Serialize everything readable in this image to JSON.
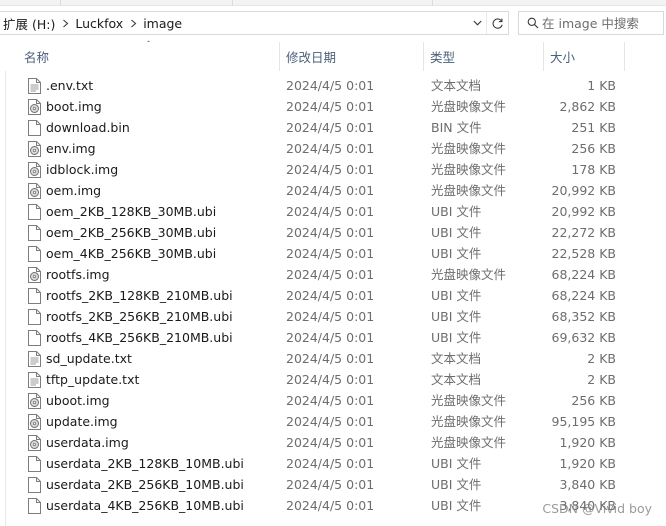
{
  "address": {
    "crumbs": [
      "扩展 (H:)",
      "Luckfox",
      "image"
    ]
  },
  "search": {
    "placeholder": "在 image 中搜索"
  },
  "columns": {
    "name": "名称",
    "date": "修改日期",
    "type": "类型",
    "size": "大小"
  },
  "files": [
    {
      "name": ".env.txt",
      "date": "2024/4/5 0:01",
      "type": "文本文档",
      "size": "1 KB",
      "icon": "text-file-icon"
    },
    {
      "name": "boot.img",
      "date": "2024/4/5 0:01",
      "type": "光盘映像文件",
      "size": "2,862 KB",
      "icon": "disc-image-icon"
    },
    {
      "name": "download.bin",
      "date": "2024/4/5 0:01",
      "type": "BIN 文件",
      "size": "251 KB",
      "icon": "file-icon"
    },
    {
      "name": "env.img",
      "date": "2024/4/5 0:01",
      "type": "光盘映像文件",
      "size": "256 KB",
      "icon": "disc-image-icon"
    },
    {
      "name": "idblock.img",
      "date": "2024/4/5 0:01",
      "type": "光盘映像文件",
      "size": "178 KB",
      "icon": "disc-image-icon"
    },
    {
      "name": "oem.img",
      "date": "2024/4/5 0:01",
      "type": "光盘映像文件",
      "size": "20,992 KB",
      "icon": "disc-image-icon"
    },
    {
      "name": "oem_2KB_128KB_30MB.ubi",
      "date": "2024/4/5 0:01",
      "type": "UBI 文件",
      "size": "20,992 KB",
      "icon": "file-icon"
    },
    {
      "name": "oem_2KB_256KB_30MB.ubi",
      "date": "2024/4/5 0:01",
      "type": "UBI 文件",
      "size": "22,272 KB",
      "icon": "file-icon"
    },
    {
      "name": "oem_4KB_256KB_30MB.ubi",
      "date": "2024/4/5 0:01",
      "type": "UBI 文件",
      "size": "22,528 KB",
      "icon": "file-icon"
    },
    {
      "name": "rootfs.img",
      "date": "2024/4/5 0:01",
      "type": "光盘映像文件",
      "size": "68,224 KB",
      "icon": "disc-image-icon"
    },
    {
      "name": "rootfs_2KB_128KB_210MB.ubi",
      "date": "2024/4/5 0:01",
      "type": "UBI 文件",
      "size": "68,224 KB",
      "icon": "file-icon"
    },
    {
      "name": "rootfs_2KB_256KB_210MB.ubi",
      "date": "2024/4/5 0:01",
      "type": "UBI 文件",
      "size": "68,352 KB",
      "icon": "file-icon"
    },
    {
      "name": "rootfs_4KB_256KB_210MB.ubi",
      "date": "2024/4/5 0:01",
      "type": "UBI 文件",
      "size": "69,632 KB",
      "icon": "file-icon"
    },
    {
      "name": "sd_update.txt",
      "date": "2024/4/5 0:01",
      "type": "文本文档",
      "size": "2 KB",
      "icon": "text-file-icon"
    },
    {
      "name": "tftp_update.txt",
      "date": "2024/4/5 0:01",
      "type": "文本文档",
      "size": "2 KB",
      "icon": "text-file-icon"
    },
    {
      "name": "uboot.img",
      "date": "2024/4/5 0:01",
      "type": "光盘映像文件",
      "size": "256 KB",
      "icon": "disc-image-icon"
    },
    {
      "name": "update.img",
      "date": "2024/4/5 0:01",
      "type": "光盘映像文件",
      "size": "95,195 KB",
      "icon": "disc-image-icon"
    },
    {
      "name": "userdata.img",
      "date": "2024/4/5 0:01",
      "type": "光盘映像文件",
      "size": "1,920 KB",
      "icon": "disc-image-icon"
    },
    {
      "name": "userdata_2KB_128KB_10MB.ubi",
      "date": "2024/4/5 0:01",
      "type": "UBI 文件",
      "size": "1,920 KB",
      "icon": "file-icon"
    },
    {
      "name": "userdata_2KB_256KB_10MB.ubi",
      "date": "2024/4/5 0:01",
      "type": "UBI 文件",
      "size": "3,840 KB",
      "icon": "file-icon"
    },
    {
      "name": "userdata_4KB_256KB_10MB.ubi",
      "date": "2024/4/5 0:01",
      "type": "UBI 文件",
      "size": "3,840 KB",
      "icon": "file-icon"
    }
  ],
  "watermark": "CSDN @Vivid boy",
  "colors": {
    "header_text": "#4c607a",
    "detail_text": "#6d6d6d",
    "border": "#d9d9d9"
  }
}
